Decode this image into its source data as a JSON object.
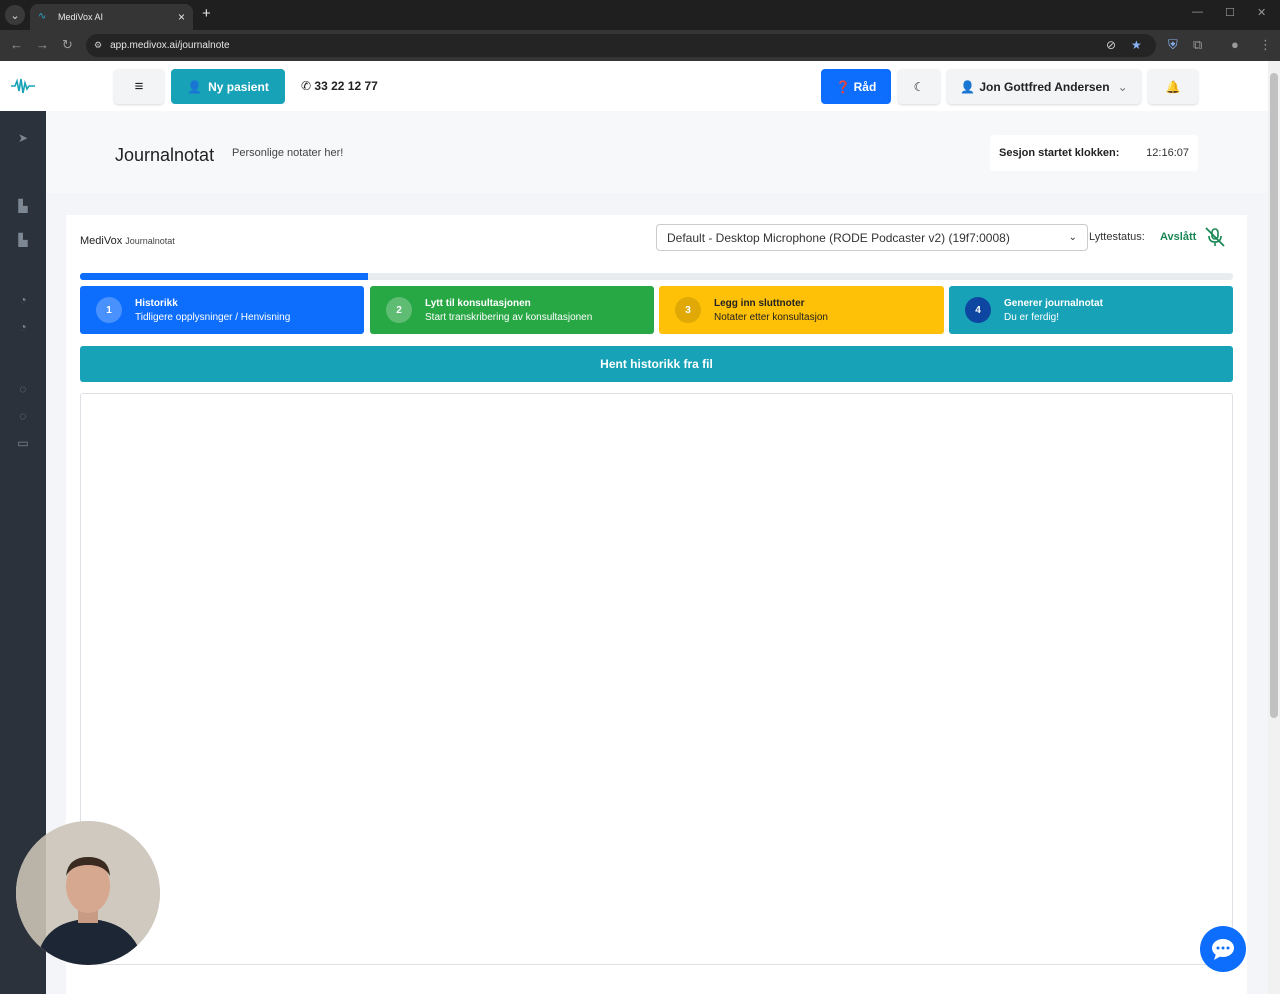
{
  "browser": {
    "tab_title": "MediVox AI",
    "url": "app.medivox.ai/journalnote"
  },
  "topnav": {
    "menu_icon": "hamburger-icon",
    "new_patient_label": "Ny pasient",
    "phone": "33 22 12 77",
    "advice_label": "Råd",
    "user_name": "Jon Gottfred Andersen"
  },
  "page": {
    "title": "Journalnotat",
    "subtitle": "Personlige notater her!",
    "session_label": "Sesjon startet klokken:",
    "session_time": "12:16:07"
  },
  "card": {
    "brand": "MediVox",
    "brand_sub": "Journalnotat",
    "microphone": "Default - Desktop Microphone (RODE Podcaster v2) (19f7:0008)",
    "listen_label": "Lyttestatus:",
    "listen_status": "Avslått",
    "progress_fraction": 0.25,
    "steps": [
      {
        "num": "1",
        "title": "Historikk",
        "sub": "Tidligere opplysninger / Henvisning",
        "color": "#0d6efd"
      },
      {
        "num": "2",
        "title": "Lytt til konsultasjonen",
        "sub": "Start transkribering av konsultasjonen",
        "color": "#28a745"
      },
      {
        "num": "3",
        "title": "Legg inn sluttnoter",
        "sub": "Notater etter konsultasjon",
        "color": "#ffc107"
      },
      {
        "num": "4",
        "title": "Generer journalnotat",
        "sub": "Du er ferdig!",
        "color": "#17a2b8"
      }
    ],
    "load_history_label": "Hent historikk fra fil"
  },
  "colors": {
    "primary": "#0d6efd",
    "teal": "#17a2b8",
    "success": "#198754",
    "sidebar": "#2b323b"
  }
}
